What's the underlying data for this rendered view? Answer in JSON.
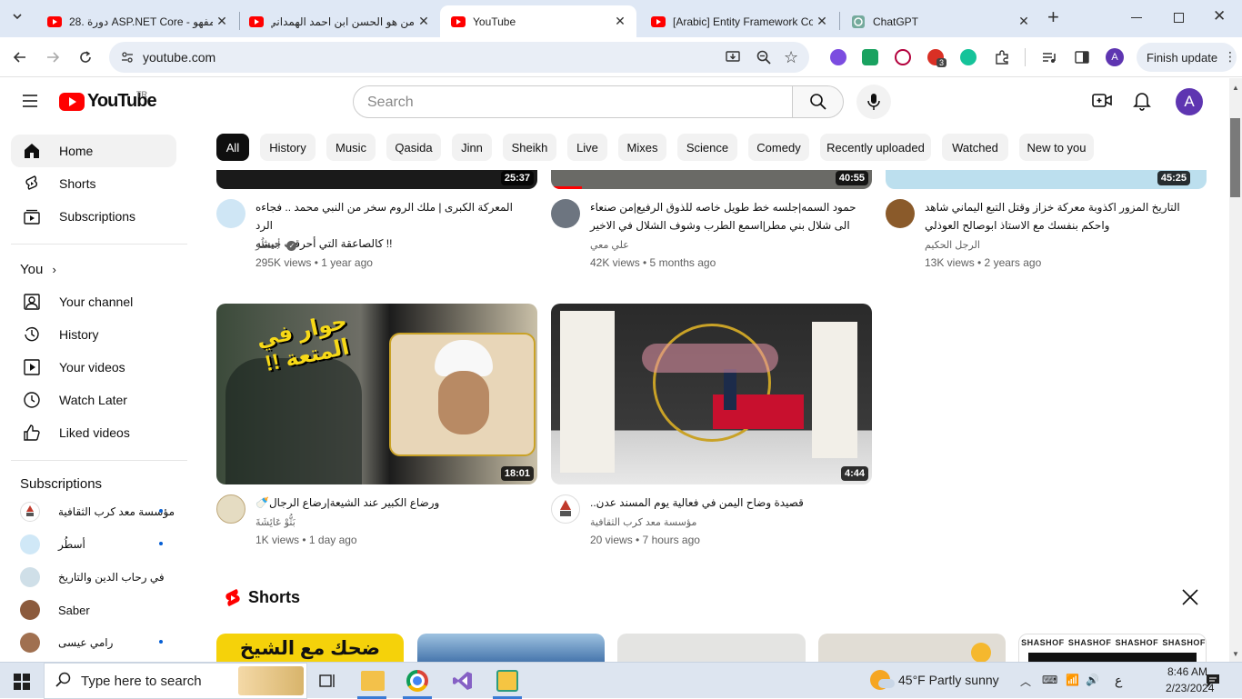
{
  "browser": {
    "tabs": [
      {
        "title": "28. دورة ASP.NET Core - مفهو",
        "favicon": "youtube-icon"
      },
      {
        "title": "من هو الحسن ابن احمد الهمداني",
        "favicon": "youtube-icon"
      },
      {
        "title": "YouTube",
        "favicon": "youtube-icon",
        "active": true
      },
      {
        "title": "[Arabic] Entity Framework Co",
        "favicon": "youtube-icon"
      },
      {
        "title": "ChatGPT",
        "favicon": "chatgpt-icon"
      }
    ],
    "new_tab": "+",
    "url": "youtube.com",
    "profile_initial": "A",
    "finish_update": "Finish update",
    "extension_badge": "3"
  },
  "masthead": {
    "logo_text": "YouTube",
    "country": "TR",
    "search_placeholder": "Search",
    "avatar_initial": "A"
  },
  "sidebar": {
    "primary": [
      {
        "label": "Home",
        "icon": "home-icon",
        "active": true
      },
      {
        "label": "Shorts",
        "icon": "shorts-icon"
      },
      {
        "label": "Subscriptions",
        "icon": "subscriptions-icon"
      }
    ],
    "you_heading": "You",
    "you_items": [
      {
        "label": "Your channel",
        "icon": "channel-icon"
      },
      {
        "label": "History",
        "icon": "history-icon"
      },
      {
        "label": "Your videos",
        "icon": "your-videos-icon"
      },
      {
        "label": "Watch Later",
        "icon": "watch-later-icon"
      },
      {
        "label": "Liked videos",
        "icon": "liked-icon"
      }
    ],
    "subscriptions_heading": "Subscriptions",
    "subscriptions": [
      {
        "name": "مؤسسة معد كرب الثقافية",
        "new": true
      },
      {
        "name": "أسطُر",
        "new": true
      },
      {
        "name": "في رحاب الدين والتاريخ",
        "new": false
      },
      {
        "name": "Saber",
        "new": false
      },
      {
        "name": "رامي عيسى",
        "new": true
      }
    ]
  },
  "chips": [
    "All",
    "History",
    "Music",
    "Qasida",
    "Jinn",
    "Sheikh",
    "Live",
    "Mixes",
    "Science",
    "Comedy",
    "Recently uploaded",
    "Watched",
    "New to you"
  ],
  "videos_row1": [
    {
      "duration": "25:37",
      "title_1": "المعركة الكبرى | ملك الروم سخر من النبي محمد .. فجاءه الرد",
      "title_2": "!! كالصاعقة التي أحرقت جيشه",
      "channel": "أسطُر",
      "verified": true,
      "meta": "295K views • 1 year ago"
    },
    {
      "duration": "40:55",
      "title_1": "حمود السمه|جلسه خط طويل خاصه للذوق الرفيع|من صنعاء",
      "title_2": "الى شلال بني مطر|اسمع الطرب وشوف الشلال في الاخير",
      "channel": "علي معي",
      "verified": false,
      "meta": "42K views • 5 months ago"
    },
    {
      "duration": "45:25",
      "title_1": "التاريخ المزور اكذوبة معركة خزاز وقتل التبع اليماني شاهد",
      "title_2": "واحكم بنفسك مع الاستاذ ابوصالح العوذلي",
      "channel": "الرجل الحكيم",
      "verified": false,
      "meta": "13K views • 2 years ago"
    }
  ],
  "videos_row2": [
    {
      "duration": "18:01",
      "thumb_text": "حوار في المتعة !!",
      "title_1": "ورضاع الكبير عند الشيعة|رضاع الرجال🍼",
      "channel": "بَثُّوْ عَائِشَةَ",
      "meta": "1K views • 1 day ago"
    },
    {
      "duration": "4:44",
      "title_1": "قصيدة وضاح اليمن في فعالية يوم المسند عدن..",
      "channel": "مؤسسة معد كرب الثقافية",
      "meta": "20 views • 7 hours ago"
    }
  ],
  "shorts": {
    "heading": "Shorts",
    "first_thumb_text": "ضحك مع الشيخ رامي",
    "last_thumb_text": "SHASHOF"
  },
  "taskbar": {
    "search_placeholder": "Type here to search",
    "weather": "45°F  Partly sunny",
    "lang": "ع",
    "time": "8:46 AM",
    "date": "2/23/2024"
  },
  "colors": {
    "accent": "#ff0000",
    "link": "#065fd4",
    "chip_active": "#0f0f0f"
  }
}
